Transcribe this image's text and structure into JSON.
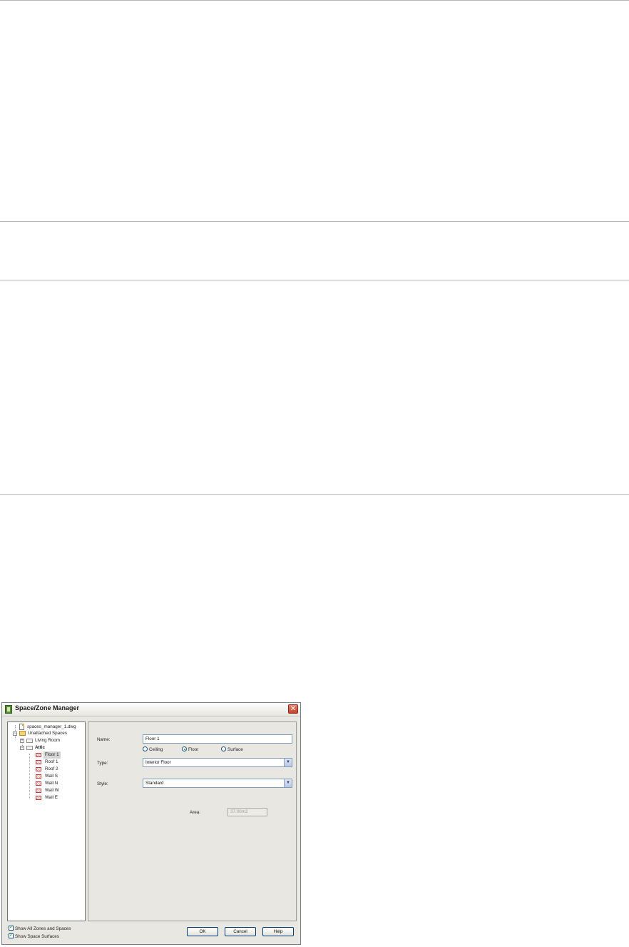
{
  "dialog": {
    "title": "Space/Zone Manager",
    "close_glyph": "✕"
  },
  "tree": {
    "items": [
      {
        "label": "spaces_manager_1.dwg",
        "icon": "drawing-file-icon"
      },
      {
        "label": "Unattached Spaces",
        "icon": "folder-icon",
        "expander": "−"
      },
      {
        "label": "Living Room",
        "icon": "space-icon",
        "expander": "+"
      },
      {
        "label": "Attic",
        "icon": "space-icon",
        "expander": "−"
      },
      {
        "label": "Floor 1",
        "icon": "surface-icon"
      },
      {
        "label": "Roof 1",
        "icon": "surface-icon"
      },
      {
        "label": "Roof 2",
        "icon": "surface-icon"
      },
      {
        "label": "Wall S",
        "icon": "surface-icon"
      },
      {
        "label": "Wall N",
        "icon": "surface-icon"
      },
      {
        "label": "Wall W",
        "icon": "surface-icon"
      },
      {
        "label": "Wall E",
        "icon": "surface-icon"
      }
    ]
  },
  "form": {
    "name_label": "Name:",
    "name_value": "Floor 1",
    "radio_ceiling": "Ceiling",
    "radio_floor": "Floor",
    "radio_surface": "Surface",
    "selected_radio": "Floor",
    "type_label": "Type:",
    "type_value": "Interior Floor",
    "style_label": "Style:",
    "style_value": "Standard",
    "area_label": "Area:",
    "area_value": "37.00m2",
    "dropdown_glyph": "▼"
  },
  "options": {
    "show_all": "Show All Zones and Spaces",
    "show_surfaces": "Show Space Surfaces"
  },
  "buttons": {
    "ok": "OK",
    "cancel": "Cancel",
    "help": "Help"
  }
}
